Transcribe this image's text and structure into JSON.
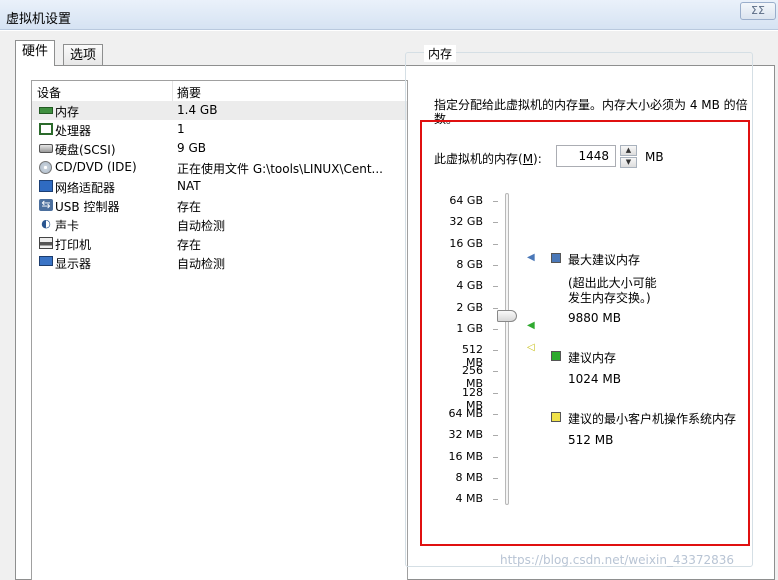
{
  "window": {
    "title": "虚拟机设置",
    "close_label": "ΣΣ"
  },
  "tabs": [
    {
      "label": "硬件",
      "selected": true
    },
    {
      "label": "选项",
      "selected": false
    }
  ],
  "device_list": {
    "columns": {
      "device": "设备",
      "summary": "摘要"
    },
    "rows": [
      {
        "icon": "memory-icon",
        "name": "内存",
        "summary": "1.4 GB",
        "selected": true
      },
      {
        "icon": "processor-icon",
        "name": "处理器",
        "summary": "1"
      },
      {
        "icon": "hard-disk-icon",
        "name": "硬盘(SCSI)",
        "summary": "9 GB"
      },
      {
        "icon": "cd-dvd-icon",
        "name": "CD/DVD (IDE)",
        "summary": "正在使用文件 G:\\tools\\LINUX\\Cent..."
      },
      {
        "icon": "network-adapter-icon",
        "name": "网络适配器",
        "summary": "NAT"
      },
      {
        "icon": "usb-icon",
        "name": "USB 控制器",
        "summary": "存在"
      },
      {
        "icon": "sound-card-icon",
        "name": "声卡",
        "summary": "自动检测"
      },
      {
        "icon": "printer-icon",
        "name": "打印机",
        "summary": "存在"
      },
      {
        "icon": "display-icon",
        "name": "显示器",
        "summary": "自动检测"
      }
    ]
  },
  "memory": {
    "group_title": "内存",
    "description": "指定分配给此虚拟机的内存量。内存大小必须为 4 MB 的倍数。",
    "field_label": "此虚拟机的内存(",
    "field_mnemonic": "M",
    "field_label_end": "):",
    "value": "1448",
    "unit": "MB",
    "scale_labels": [
      "64 GB",
      "32 GB",
      "16 GB",
      "8 GB",
      "4 GB",
      "2 GB",
      "1 GB",
      "512 MB",
      "256 MB",
      "128 MB",
      "64 MB",
      "32 MB",
      "16 MB",
      "8 MB",
      "4 MB"
    ],
    "slider_value_mb": 1448,
    "legend": {
      "max": {
        "label": "最大建议内存",
        "note_line1": "(超出此大小可能",
        "note_line2": "发生内存交换。)",
        "value": "9880 MB",
        "color": "#4a78b8"
      },
      "recommended": {
        "label": "建议内存",
        "value": "1024 MB",
        "color": "#2faa2f"
      },
      "min": {
        "label": "建议的最小客户机操作系统内存",
        "value": "512 MB",
        "color": "#f0e24a"
      }
    }
  },
  "watermark": "https://blog.csdn.net/weixin_43372836",
  "colors": {
    "highlight": "#e01010"
  }
}
